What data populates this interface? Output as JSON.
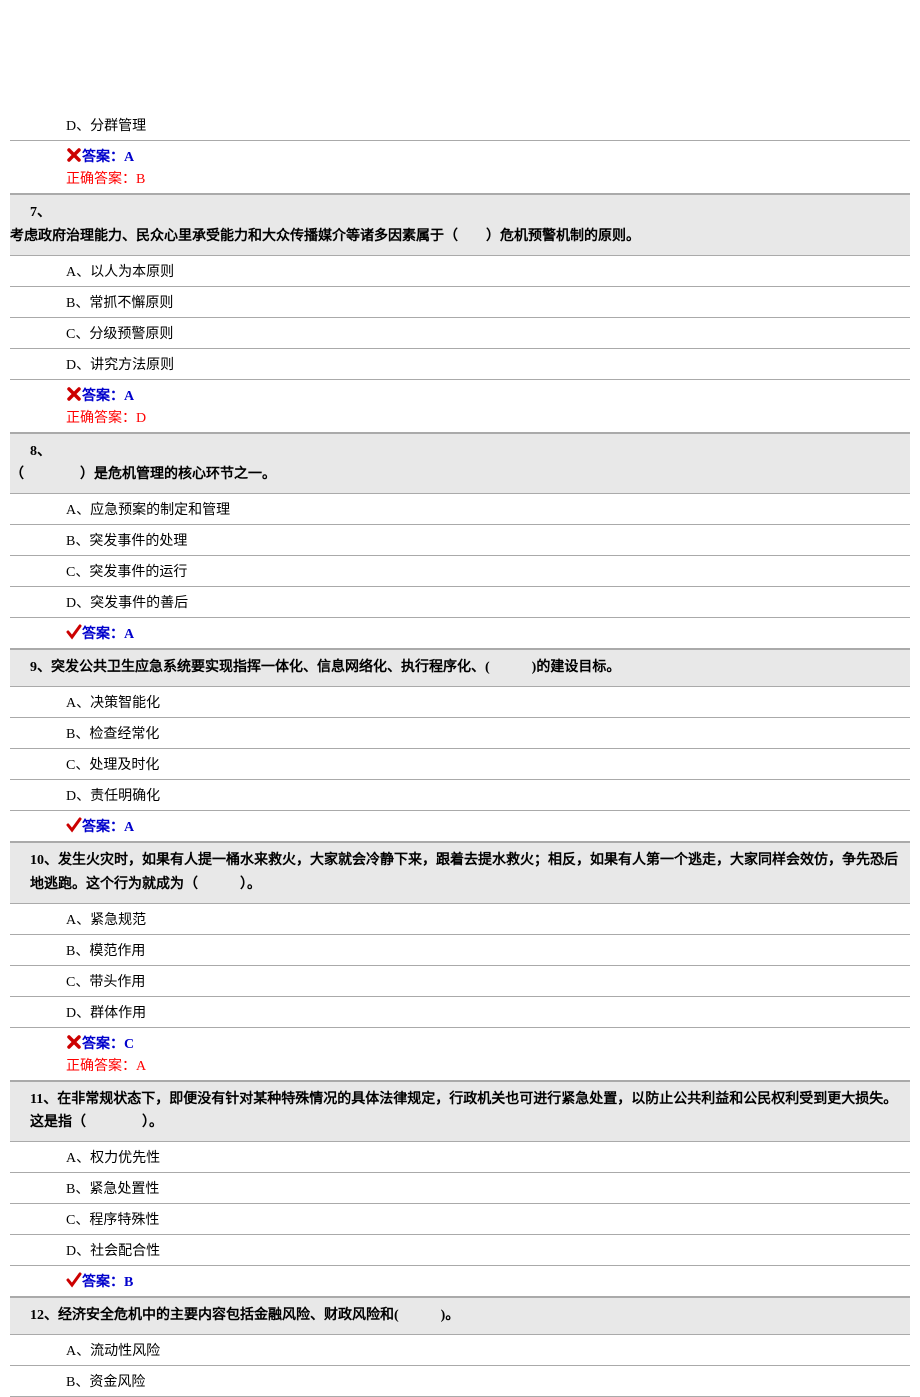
{
  "questions": [
    {
      "number": "",
      "stem": "",
      "stem_inline": false,
      "options": [
        "D、分群管理"
      ],
      "user_answer": "答案：A",
      "user_correct": false,
      "correct_answer": "正确答案：B"
    },
    {
      "number": "7、",
      "stem": "考虑政府治理能力、民众心里承受能力和大众传播媒介等诸多因素属于（　　）危机预警机制的原则。",
      "stem_inline": false,
      "options": [
        "A、以人为本原则",
        "B、常抓不懈原则",
        "C、分级预警原则",
        "D、讲究方法原则"
      ],
      "user_answer": "答案：A",
      "user_correct": false,
      "correct_answer": "正确答案：D"
    },
    {
      "number": "8、",
      "stem": "（　　　　）是危机管理的核心环节之一。",
      "stem_inline": false,
      "options": [
        "A、应急预案的制定和管理",
        "B、突发事件的处理",
        "C、突发事件的运行",
        "D、突发事件的善后"
      ],
      "user_answer": "答案：A",
      "user_correct": true,
      "correct_answer": ""
    },
    {
      "number": "9、",
      "stem": "突发公共卫生应急系统要实现指挥一体化、信息网络化、执行程序化、(　　　)的建设目标。",
      "stem_inline": true,
      "options": [
        "A、决策智能化",
        "B、检查经常化",
        "C、处理及时化",
        "D、责任明确化"
      ],
      "user_answer": "答案：A",
      "user_correct": true,
      "correct_answer": ""
    },
    {
      "number": "10、",
      "stem": "发生火灾时，如果有人提一桶水来救火，大家就会冷静下来，跟着去提水救火；相反，如果有人第一个逃走，大家同样会效仿，争先恐后地逃跑。这个行为就成为（　　　）。",
      "stem_inline": true,
      "options": [
        "A、紧急规范",
        "B、模范作用",
        "C、带头作用",
        "D、群体作用"
      ],
      "user_answer": "答案：C",
      "user_correct": false,
      "correct_answer": "正确答案：A"
    },
    {
      "number": "11、",
      "stem": "在非常规状态下，即便没有针对某种特殊情况的具体法律规定，行政机关也可进行紧急处置，以防止公共利益和公民权利受到更大损失。这是指（　　　　）。",
      "stem_inline": true,
      "options": [
        "A、权力优先性",
        "B、紧急处置性",
        "C、程序特殊性",
        "D、社会配合性"
      ],
      "user_answer": "答案：B",
      "user_correct": true,
      "correct_answer": ""
    },
    {
      "number": "12、",
      "stem": "经济安全危机中的主要内容包括金融风险、财政风险和(　　　)。",
      "stem_inline": true,
      "options": [
        "A、流动性风险",
        "B、资金风险"
      ],
      "user_answer": "",
      "user_correct": null,
      "correct_answer": ""
    }
  ]
}
